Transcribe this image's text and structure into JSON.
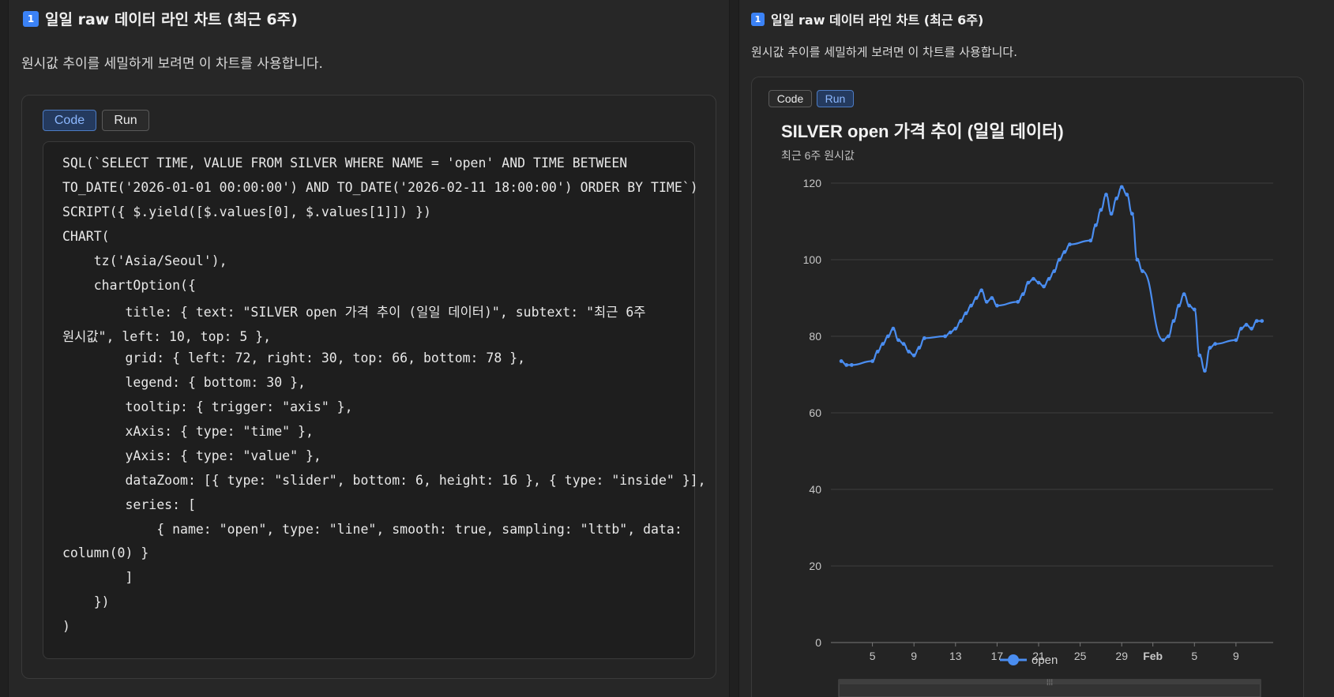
{
  "left": {
    "heading": "일일 raw 데이터 라인 차트 (최근 6주)",
    "badge": "1",
    "description": "원시값 추이를 세밀하게 보려면 이 차트를 사용합니다.",
    "tabs": {
      "code": "Code",
      "run": "Run"
    },
    "code_lines": [
      "SQL(`SELECT TIME, VALUE FROM SILVER WHERE NAME = 'open' AND TIME BETWEEN",
      "TO_DATE('2026-01-01 00:00:00') AND TO_DATE('2026-02-11 18:00:00') ORDER BY TIME`)",
      "SCRIPT({ $.yield([$.values[0], $.values[1]]) })",
      "CHART(",
      "    tz('Asia/Seoul'),",
      "    chartOption({",
      "        title: { text: \"SILVER open 가격 추이 (일일 데이터)\", subtext: \"최근 6주",
      "원시값\", left: 10, top: 5 },",
      "        grid: { left: 72, right: 30, top: 66, bottom: 78 },",
      "        legend: { bottom: 30 },",
      "        tooltip: { trigger: \"axis\" },",
      "        xAxis: { type: \"time\" },",
      "        yAxis: { type: \"value\" },",
      "        dataZoom: [{ type: \"slider\", bottom: 6, height: 16 }, { type: \"inside\" }],",
      "        series: [",
      "            { name: \"open\", type: \"line\", smooth: true, sampling: \"lttb\", data:",
      "column(0) }",
      "        ]",
      "    })",
      ")"
    ]
  },
  "right": {
    "heading": "일일 raw 데이터 라인 차트 (최근 6주)",
    "badge": "1",
    "description": "원시값 추이를 세밀하게 보려면 이 차트를 사용합니다.",
    "tabs": {
      "code": "Code",
      "run": "Run"
    }
  },
  "colors": {
    "series": "#4a8df0",
    "accent": "#3b82f6"
  },
  "chart_data": {
    "type": "line",
    "title": "SILVER open 가격 추이 (일일 데이터)",
    "subtitle": "최근 6주 원시값",
    "x_tick_labels": [
      "5",
      "9",
      "13",
      "17",
      "21",
      "25",
      "29",
      "Feb",
      "5",
      "9"
    ],
    "y_tick_labels": [
      "0",
      "20",
      "40",
      "60",
      "80",
      "100",
      "120"
    ],
    "ylim": [
      0,
      120
    ],
    "legend": {
      "placement": "bottom",
      "entries": [
        "open"
      ]
    },
    "grid": true,
    "datazoom": "slider",
    "series": [
      {
        "name": "open",
        "x": [
          "2026-01-02",
          "2026-01-02T12:00",
          "2026-01-03",
          "2026-01-05",
          "2026-01-05T12:00",
          "2026-01-06",
          "2026-01-06T12:00",
          "2026-01-07",
          "2026-01-07T12:00",
          "2026-01-08",
          "2026-01-08T12:00",
          "2026-01-09",
          "2026-01-09T12:00",
          "2026-01-10",
          "2026-01-12",
          "2026-01-12T12:00",
          "2026-01-13",
          "2026-01-13T12:00",
          "2026-01-14",
          "2026-01-14T12:00",
          "2026-01-15",
          "2026-01-15T12:00",
          "2026-01-16",
          "2026-01-16T12:00",
          "2026-01-17",
          "2026-01-19",
          "2026-01-19T12:00",
          "2026-01-20",
          "2026-01-20T12:00",
          "2026-01-21",
          "2026-01-21T12:00",
          "2026-01-22",
          "2026-01-22T12:00",
          "2026-01-23",
          "2026-01-23T12:00",
          "2026-01-24",
          "2026-01-26",
          "2026-01-26T12:00",
          "2026-01-27",
          "2026-01-27T12:00",
          "2026-01-28",
          "2026-01-28T12:00",
          "2026-01-29",
          "2026-01-29T12:00",
          "2026-01-30",
          "2026-01-30T12:00",
          "2026-01-31",
          "2026-02-02",
          "2026-02-02T12:00",
          "2026-02-03",
          "2026-02-03T12:00",
          "2026-02-04",
          "2026-02-04T12:00",
          "2026-02-05",
          "2026-02-05T12:00",
          "2026-02-06",
          "2026-02-06T12:00",
          "2026-02-07",
          "2026-02-09",
          "2026-02-09T12:00",
          "2026-02-10",
          "2026-02-10T12:00",
          "2026-02-11",
          "2026-02-11T12:00"
        ],
        "values": [
          73.5,
          72.5,
          72.5,
          73.5,
          76,
          78,
          80,
          82,
          79,
          78,
          76,
          75,
          77,
          79.5,
          80,
          81,
          82,
          84,
          86,
          88,
          90,
          92,
          89,
          90,
          88,
          89,
          91,
          94,
          95,
          94,
          93,
          95,
          97,
          100,
          102,
          104,
          105,
          109,
          113,
          117,
          112,
          116,
          119,
          117,
          112,
          100,
          97,
          79,
          80,
          84,
          88,
          91,
          88,
          87,
          75,
          71,
          77,
          78,
          79,
          82,
          83,
          82,
          84,
          84
        ]
      }
    ]
  }
}
